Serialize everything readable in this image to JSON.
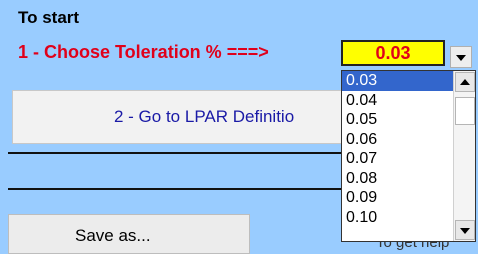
{
  "sheet": {
    "heading": "To start",
    "step1_label": "1 - Choose Toleration % ===>",
    "step2_button": "2 - Go to LPAR Definitio",
    "save_button": "Save as...",
    "partial_text": "To get help"
  },
  "tolerance_combo": {
    "value": "0.03",
    "options": [
      "0.03",
      "0.04",
      "0.05",
      "0.06",
      "0.07",
      "0.08",
      "0.09",
      "0.10"
    ],
    "selected_index": 0
  },
  "colors": {
    "sheet_background": "#99ccff",
    "label_red": "#e0001a",
    "combo_yellow": "#ffff00",
    "link_blue": "#1a1aa6",
    "selection_blue": "#3366cc"
  },
  "icons": {
    "combo_button": "chevron-down-icon",
    "scroll_up": "scroll-up-arrow-icon",
    "scroll_down": "scroll-down-arrow-icon"
  }
}
